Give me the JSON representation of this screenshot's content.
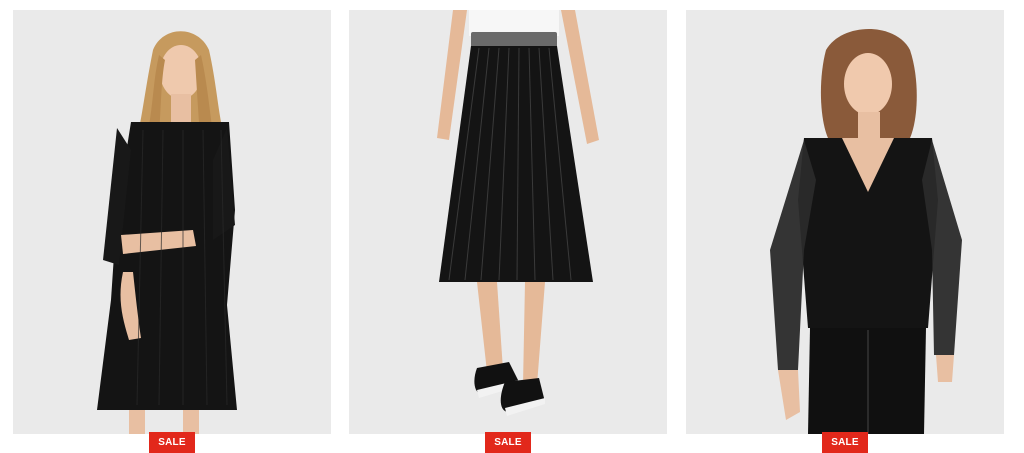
{
  "products": [
    {
      "badge": "SALE"
    },
    {
      "badge": "SALE"
    },
    {
      "badge": "SALE"
    }
  ],
  "colors": {
    "card_background": "#eaeaea",
    "sale_badge": "#e2281b",
    "garment": "#141414"
  }
}
